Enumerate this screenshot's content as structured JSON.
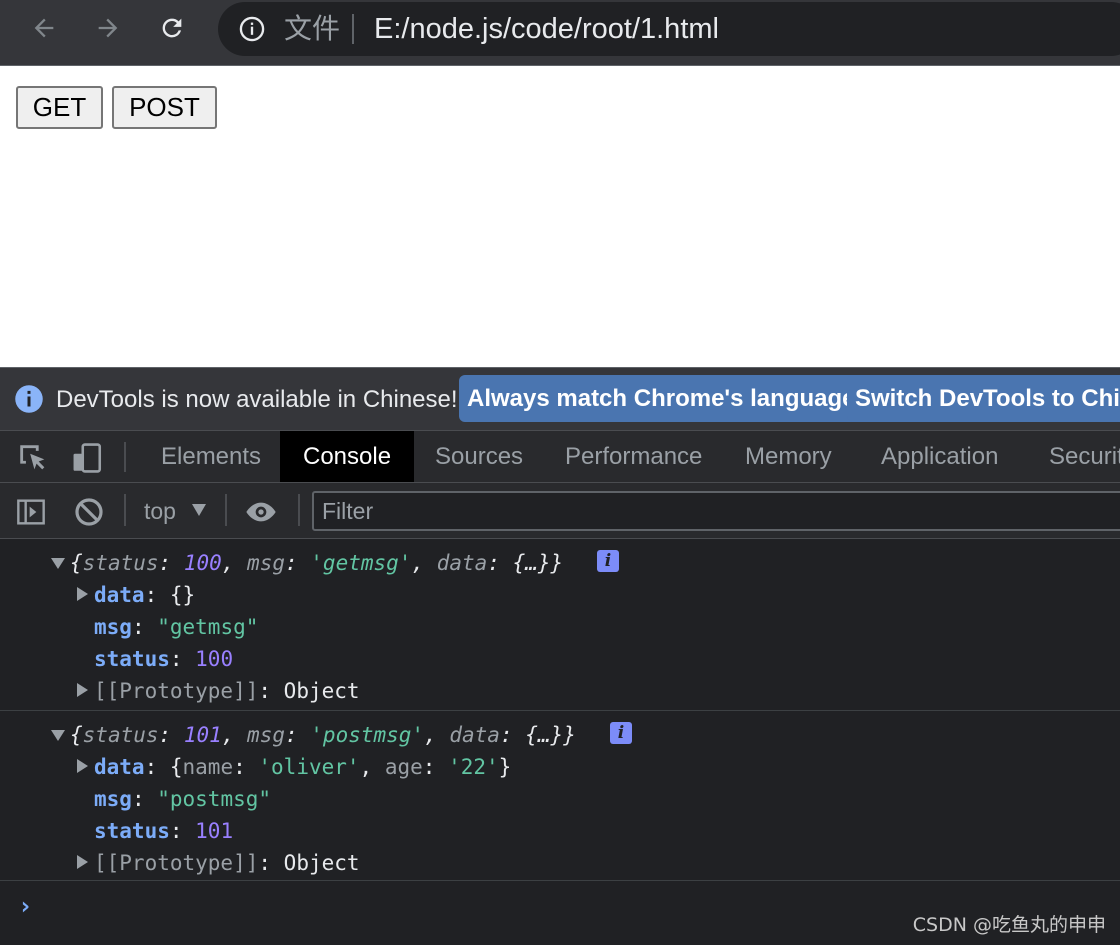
{
  "browser": {
    "file_label": "文件",
    "url": "E:/node.js/code/root/1.html"
  },
  "page": {
    "buttons": {
      "get": "GET",
      "post": "POST"
    }
  },
  "devtools": {
    "infobar": {
      "message": "DevTools is now available in Chinese!",
      "btn_match": "Always match Chrome's language",
      "btn_switch": "Switch DevTools to Chinese"
    },
    "tabs": [
      "Elements",
      "Console",
      "Sources",
      "Performance",
      "Memory",
      "Application",
      "Security"
    ],
    "active_tab": "Console",
    "toolbar": {
      "context": "top",
      "filter_placeholder": "Filter"
    },
    "console": {
      "entries": [
        {
          "summary": {
            "status": "100",
            "msg": "'getmsg'",
            "data": "{…}"
          },
          "data_preview": "{}",
          "msg": "\"getmsg\"",
          "status": "100",
          "prototype": "Object"
        },
        {
          "summary": {
            "status": "101",
            "msg": "'postmsg'",
            "data": "{…}"
          },
          "data_preview": {
            "name": "'oliver'",
            "age": "'22'"
          },
          "msg": "\"postmsg\"",
          "status": "101",
          "prototype": "Object"
        }
      ],
      "prompt": "›"
    }
  },
  "watermark": "CSDN @吃鱼丸的申申"
}
